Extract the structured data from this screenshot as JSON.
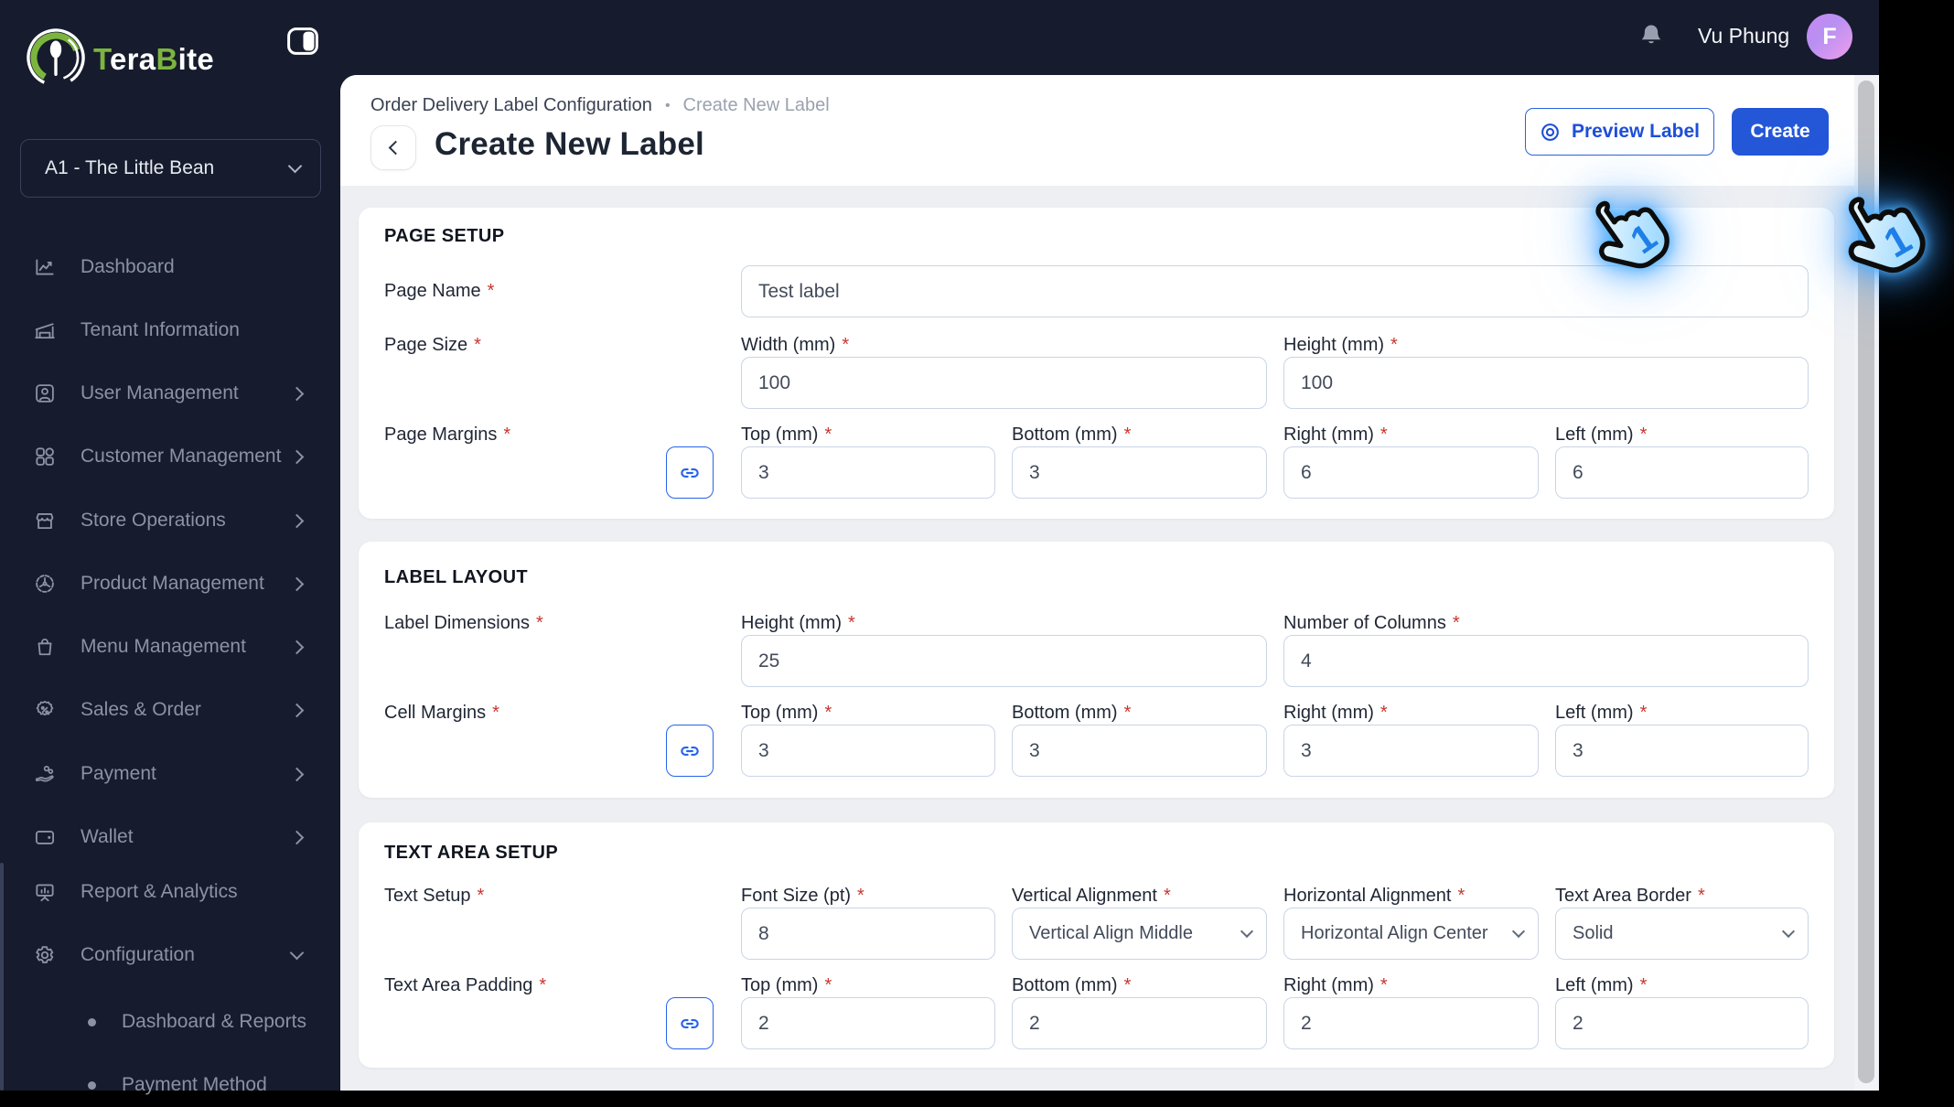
{
  "ui": {
    "required_marker": "*",
    "breadcrumb_separator": "•",
    "cursor_badge": "1"
  },
  "brand": {
    "logo_part1": "T",
    "logo_part2": "era",
    "logo_part3": "B",
    "logo_part4": "ite"
  },
  "topbar": {
    "user_name": "Vu Phung",
    "avatar_initial": "F"
  },
  "sidebar": {
    "store_selector": {
      "value": "A1 - The Little Bean"
    },
    "items": [
      {
        "label": "Dashboard"
      },
      {
        "label": "Tenant Information"
      },
      {
        "label": "User Management"
      },
      {
        "label": "Customer Management"
      },
      {
        "label": "Store Operations"
      },
      {
        "label": "Product Management"
      },
      {
        "label": "Menu Management"
      },
      {
        "label": "Sales & Order"
      },
      {
        "label": "Payment"
      },
      {
        "label": "Wallet"
      },
      {
        "label": "Report & Analytics"
      },
      {
        "label": "Configuration"
      }
    ],
    "sub_items": [
      {
        "label": "Dashboard & Reports"
      },
      {
        "label": "Payment Method"
      }
    ]
  },
  "page_header": {
    "breadcrumb_parent": "Order Delivery Label Configuration",
    "breadcrumb_current": "Create New Label",
    "title": "Create New Label",
    "preview_label": "Preview Label",
    "create_label": "Create"
  },
  "form": {
    "page_setup": {
      "title": "PAGE SETUP",
      "page_name": {
        "label": "Page Name",
        "value": "Test label"
      },
      "page_size": {
        "label": "Page Size",
        "fields": [
          {
            "label": "Width (mm)",
            "value": "100"
          },
          {
            "label": "Height (mm)",
            "value": "100"
          }
        ]
      },
      "page_margins": {
        "label": "Page Margins",
        "fields": [
          {
            "label": "Top (mm)",
            "value": "3"
          },
          {
            "label": "Bottom (mm)",
            "value": "3"
          },
          {
            "label": "Right (mm)",
            "value": "6"
          },
          {
            "label": "Left (mm)",
            "value": "6"
          }
        ]
      }
    },
    "label_layout": {
      "title": "LABEL LAYOUT",
      "label_dimensions": {
        "label": "Label Dimensions",
        "fields": [
          {
            "label": "Height (mm)",
            "value": "25"
          },
          {
            "label": "Number of Columns",
            "value": "4"
          }
        ]
      },
      "cell_margins": {
        "label": "Cell Margins",
        "fields": [
          {
            "label": "Top (mm)",
            "value": "3"
          },
          {
            "label": "Bottom (mm)",
            "value": "3"
          },
          {
            "label": "Right (mm)",
            "value": "3"
          },
          {
            "label": "Left (mm)",
            "value": "3"
          }
        ]
      }
    },
    "text_area_setup": {
      "title": "TEXT AREA SETUP",
      "text_setup": {
        "label": "Text Setup",
        "fields": [
          {
            "label": "Font Size (pt)",
            "value": "8"
          },
          {
            "label": "Vertical Alignment",
            "value": "Vertical Align Middle"
          },
          {
            "label": "Horizontal Alignment",
            "value": "Horizontal Align Center"
          },
          {
            "label": "Text Area Border",
            "value": "Solid"
          }
        ]
      },
      "text_area_padding": {
        "label": "Text Area Padding",
        "fields": [
          {
            "label": "Top (mm)",
            "value": "2"
          },
          {
            "label": "Bottom (mm)",
            "value": "2"
          },
          {
            "label": "Right (mm)",
            "value": "2"
          },
          {
            "label": "Left (mm)",
            "value": "2"
          }
        ]
      }
    }
  },
  "colors": {
    "accent_blue": "#2563eb",
    "create_button": "#2456d8",
    "brand_green": "#7cb53e",
    "sidebar_bg": "#161c2d",
    "required_red": "#c8352e"
  }
}
